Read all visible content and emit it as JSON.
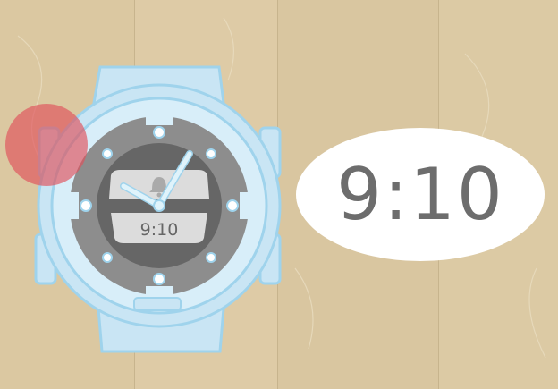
{
  "watch": {
    "lcd_time": "9:10",
    "alarm_icon": "bell-icon",
    "highlight_target": "side-button-left"
  },
  "callout": {
    "time_text": "9:10"
  },
  "colors": {
    "wood": "#dcc9a3",
    "strap": "#c9e5f4",
    "case_outline": "#9fd3ec",
    "bezel": "#8d8d8d",
    "dial": "#666666",
    "lcd": "#dcdcdc",
    "hands": "#dff3fb",
    "highlight": "#e0505a",
    "callout_text": "#6d6d6d"
  }
}
